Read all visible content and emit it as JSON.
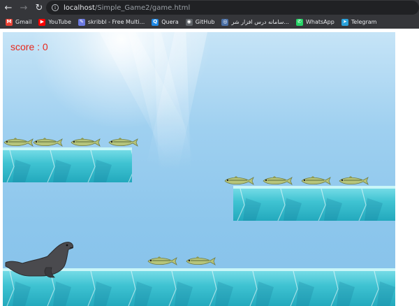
{
  "browser": {
    "nav": {
      "back_icon": "←",
      "forward_icon": "→",
      "reload_icon": "↻"
    },
    "url_host": "localhost",
    "url_path": "/Simple_Game2/game.html",
    "bookmarks": [
      {
        "label": "Gmail",
        "icon": "M",
        "icon_color": "#ea4335"
      },
      {
        "label": "YouTube",
        "icon": "▶",
        "icon_color": "#ff0000"
      },
      {
        "label": "skribbl - Free Multi...",
        "icon": "✎",
        "icon_color": "#6c7ae0"
      },
      {
        "label": "Quera",
        "icon": "Q",
        "icon_color": "#1e88e5"
      },
      {
        "label": "GitHub",
        "icon": "◉",
        "icon_color": "#5f6368"
      },
      {
        "label": "سامانه درس افزار شر...",
        "icon": "◎",
        "icon_color": "#4a6fa5"
      },
      {
        "label": "WhatsApp",
        "icon": "✆",
        "icon_color": "#25d366"
      },
      {
        "label": "Telegram",
        "icon": "➤",
        "icon_color": "#2aa1da"
      }
    ]
  },
  "game": {
    "score_label": "score : 0",
    "colors": {
      "ice_top": "#7fe0ea",
      "ice_mid": "#3fc3d2",
      "ice_dark": "#23a9bd",
      "fish_body": "#b6c47a",
      "fish_stripe": "#5a6b3a",
      "seal": "#4a4a4e",
      "score": "#e8281c"
    }
  }
}
